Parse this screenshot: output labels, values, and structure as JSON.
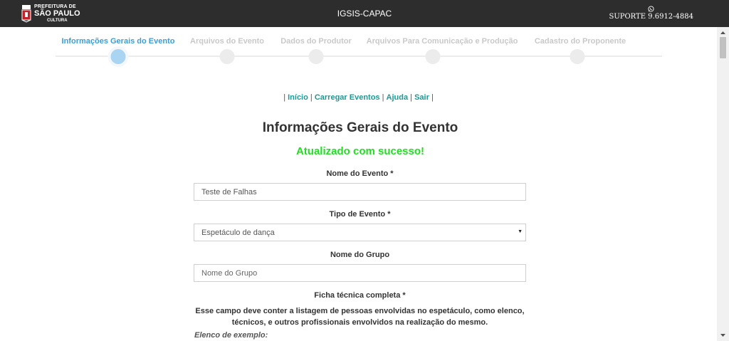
{
  "header": {
    "logo": {
      "line1": "PREFEITURA DE",
      "line2": "SÃO PAULO",
      "line3": "CULTURA"
    },
    "app_title": "IGSIS-CAPAC",
    "support": {
      "icon": "whatsapp-icon",
      "text": "SUPORTE 9.6912-4884"
    }
  },
  "steps": [
    {
      "label": "Informações Gerais do Evento",
      "active": true
    },
    {
      "label": "Arquivos do Evento",
      "active": false
    },
    {
      "label": "Dados do Produtor",
      "active": false
    },
    {
      "label": "Arquivos Para Comunicação e Produção",
      "active": false
    },
    {
      "label": "Cadastro do Proponente",
      "active": false
    }
  ],
  "nav": {
    "sep": "|",
    "inicio": "Início",
    "carregar": "Carregar Eventos",
    "ajuda": "Ajuda",
    "sair": "Sair"
  },
  "page_title": "Informações Gerais do Evento",
  "success_message": "Atualizado com sucesso!",
  "form": {
    "nome_evento": {
      "label": "Nome do Evento *",
      "value": "Teste de Falhas"
    },
    "tipo_evento": {
      "label": "Tipo de Evento *",
      "value": "Espetáculo de dança"
    },
    "nome_grupo": {
      "label": "Nome do Grupo",
      "value": "",
      "placeholder": "Nome do Grupo"
    },
    "ficha_tecnica": {
      "label": "Ficha técnica completa *",
      "help_line1": "Esse campo deve conter a listagem de pessoas envolvidas no espetáculo, como elenco,",
      "help_line2": "técnicos, e outros profissionais envolvidos na realização do mesmo.",
      "example_label": "Elenco de exemplo:"
    }
  },
  "colors": {
    "topbar": "#2d2d2d",
    "active_step": "#3a9fd5",
    "link": "#1a9a95",
    "success": "#22dd22"
  }
}
